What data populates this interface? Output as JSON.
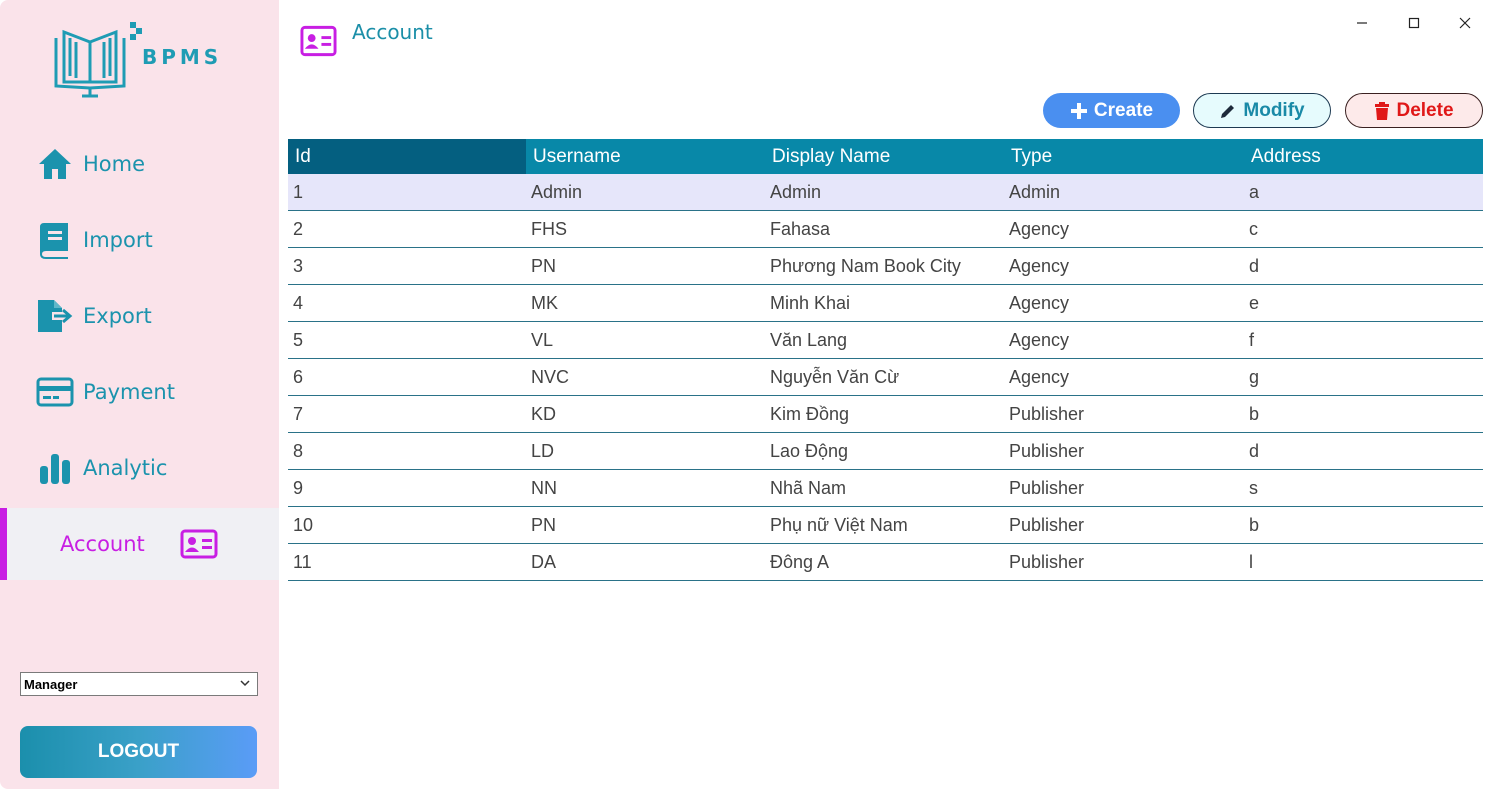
{
  "app": {
    "logo_text": "BPMS"
  },
  "sidebar": {
    "items": [
      {
        "label": "Home",
        "icon": "home-icon"
      },
      {
        "label": "Import",
        "icon": "book-icon"
      },
      {
        "label": "Export",
        "icon": "file-export-icon"
      },
      {
        "label": "Payment",
        "icon": "credit-card-icon"
      },
      {
        "label": "Analytic",
        "icon": "bar-chart-icon"
      },
      {
        "label": "Account",
        "icon": "id-card-icon",
        "active": true
      }
    ],
    "role_select": {
      "value": "Manager"
    },
    "logout_label": "LOGOUT"
  },
  "header": {
    "title": "Account",
    "icon": "id-card-icon"
  },
  "toolbar": {
    "create_label": "Create",
    "modify_label": "Modify",
    "delete_label": "Delete"
  },
  "table": {
    "columns": [
      "Id",
      "Username",
      "Display Name",
      "Type",
      "Address"
    ],
    "rows": [
      [
        "1",
        "Admin",
        "Admin",
        "Admin",
        "a"
      ],
      [
        "2",
        "FHS",
        "Fahasa",
        "Agency",
        "c"
      ],
      [
        "3",
        "PN",
        "Phương Nam Book City",
        "Agency",
        "d"
      ],
      [
        "4",
        "MK",
        "Minh Khai",
        "Agency",
        "e"
      ],
      [
        "5",
        "VL",
        "Văn Lang",
        "Agency",
        "f"
      ],
      [
        "6",
        "NVC",
        "Nguyễn Văn Cừ",
        "Agency",
        "g"
      ],
      [
        "7",
        "KD",
        "Kim Đồng",
        "Publisher",
        "b"
      ],
      [
        "8",
        "LD",
        "Lao Động",
        "Publisher",
        "d"
      ],
      [
        "9",
        "NN",
        "Nhã Nam",
        "Publisher",
        "s"
      ],
      [
        "10",
        "PN",
        "Phụ nữ Việt Nam",
        "Publisher",
        "b"
      ],
      [
        "11",
        "DA",
        "Đông A",
        "Publisher",
        "l"
      ]
    ],
    "selected_row": 0
  },
  "colors": {
    "sidebar_bg": "#fae3ea",
    "accent_teal": "#1b93ad",
    "accent_magenta": "#c81ee3",
    "header_bg": "#0888a8"
  }
}
